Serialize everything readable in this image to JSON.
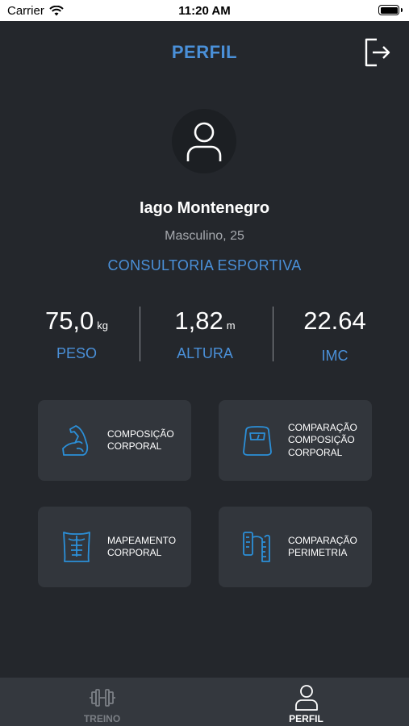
{
  "status_bar": {
    "carrier": "Carrier",
    "time": "11:20 AM"
  },
  "header": {
    "title": "PERFIL",
    "logout_icon": "logout-icon"
  },
  "profile": {
    "avatar_icon": "user-icon",
    "name": "Iago Montenegro",
    "details": "Masculino, 25",
    "plan": "CONSULTORIA ESPORTIVA"
  },
  "stats": [
    {
      "value": "75,0",
      "unit": "kg",
      "label": "PESO"
    },
    {
      "value": "1,82",
      "unit": "m",
      "label": "ALTURA"
    },
    {
      "value": "22.64",
      "unit": "",
      "label": "IMC"
    }
  ],
  "cards": [
    {
      "label": "COMPOSIÇÃO\nCORPORAL",
      "icon": "flexed-arm-icon"
    },
    {
      "label": "COMPARAÇÃO\nCOMPOSIÇÃO\nCORPORAL",
      "icon": "scale-icon"
    },
    {
      "label": "MAPEAMENTO\nCORPORAL",
      "icon": "torso-icon"
    },
    {
      "label": "COMPARAÇÃO\nPERIMETRIA",
      "icon": "measuring-tape-icon"
    }
  ],
  "tabs": [
    {
      "label": "TREINO",
      "icon": "dumbbell-icon",
      "active": false
    },
    {
      "label": "PERFIL",
      "icon": "user-icon",
      "active": true
    }
  ],
  "colors": {
    "accent": "#4a90d9",
    "background": "#24272c",
    "card": "#32363c",
    "tabbar": "#34383e"
  }
}
